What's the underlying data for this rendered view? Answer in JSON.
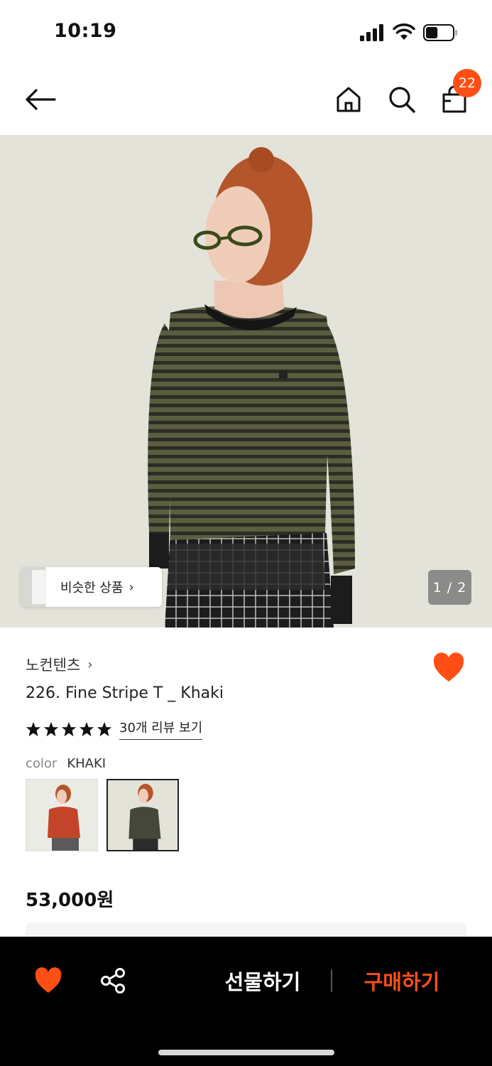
{
  "status_bar": {
    "time": "10:19",
    "signal_icon": "cellular-signal-icon",
    "wifi_icon": "wifi-icon",
    "battery_icon": "battery-icon",
    "battery_level": 0.45
  },
  "nav": {
    "back_icon": "arrow-left-icon",
    "home_icon": "home-icon",
    "search_icon": "search-icon",
    "cart_icon": "shopping-bag-icon",
    "cart_count": "22"
  },
  "gallery": {
    "similar_label": "비슷한 상품",
    "similar_chevron": "›",
    "page_indicator": "1 / 2"
  },
  "product": {
    "brand": "노컨텐츠",
    "brand_chevron": "›",
    "name": "226. Fine Stripe T _ Khaki",
    "rating_stars": 5,
    "review_link": "30개 리뷰 보기",
    "color_label": "color",
    "color_value": "KHAKI",
    "swatches": [
      {
        "color": "red",
        "selected": false
      },
      {
        "color": "khaki",
        "selected": true
      }
    ],
    "price": "53,000원",
    "favorited": true
  },
  "bottom_bar": {
    "gift_label": "선물하기",
    "buy_label": "구매하기",
    "heart_icon": "heart-icon",
    "share_icon": "share-icon"
  },
  "colors": {
    "accent": "#ff4f14",
    "bottom_bar_bg": "#000000"
  }
}
